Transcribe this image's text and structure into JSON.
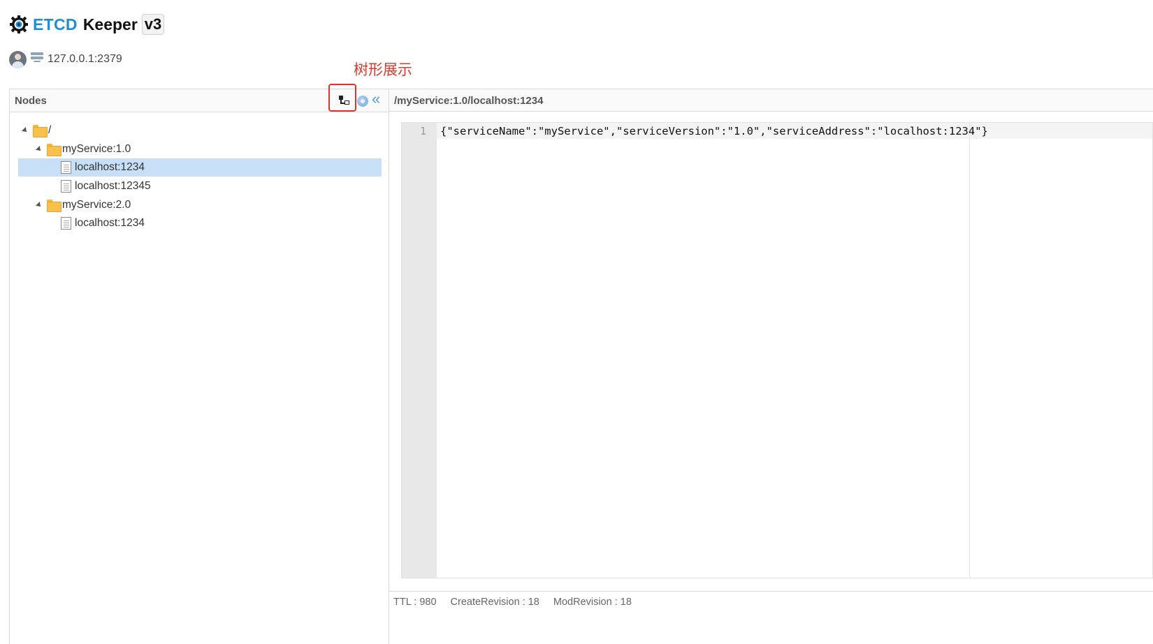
{
  "header": {
    "brand_primary": "ETCD",
    "brand_secondary": "Keeper",
    "version": "v3",
    "logo_icon": "gear-eye-icon"
  },
  "connection": {
    "address": "127.0.0.1:2379",
    "avatar_icon": "user-avatar-icon",
    "server_icon": "server-icon"
  },
  "annotation": {
    "label": "树形展示",
    "color": "#e03a2a"
  },
  "nodes_panel": {
    "title": "Nodes",
    "tools": [
      "tree-view-icon",
      "refresh-icon",
      "collapse-left-icon"
    ]
  },
  "tree": [
    {
      "label": "/",
      "type": "folder",
      "expanded": true,
      "depth": 0
    },
    {
      "label": "myService:1.0",
      "type": "folder",
      "expanded": true,
      "depth": 1
    },
    {
      "label": "localhost:1234",
      "type": "file",
      "selected": true,
      "depth": 2
    },
    {
      "label": "localhost:12345",
      "type": "file",
      "depth": 2
    },
    {
      "label": "myService:2.0",
      "type": "folder",
      "expanded": true,
      "depth": 1
    },
    {
      "label": "localhost:1234",
      "type": "file",
      "depth": 2
    }
  ],
  "editor": {
    "path": "/myService:1.0/localhost:1234",
    "line_number": "1",
    "content": "{\"serviceName\":\"myService\",\"serviceVersion\":\"1.0\",\"serviceAddress\":\"localhost:1234\"}"
  },
  "footer": {
    "ttl": "TTL : 980",
    "create_revision": "CreateRevision : 18",
    "mod_revision": "ModRevision : 18"
  },
  "colors": {
    "accent": "#1e8fd6",
    "selection": "#c7e0f7",
    "annotation": "#e03a2a"
  }
}
